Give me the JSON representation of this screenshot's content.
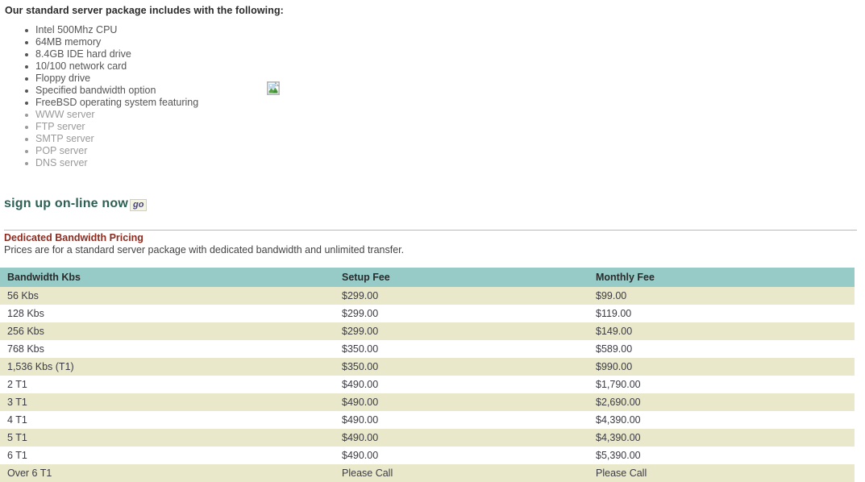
{
  "intro": {
    "heading": "Our standard server package includes with the following:",
    "features": [
      {
        "label": "Intel 500Mhz CPU",
        "muted": false
      },
      {
        "label": "64MB memory",
        "muted": false
      },
      {
        "label": "8.4GB IDE hard drive",
        "muted": false
      },
      {
        "label": "10/100 network card",
        "muted": false
      },
      {
        "label": "Floppy drive",
        "muted": false
      },
      {
        "label": "Specified bandwidth option",
        "muted": false
      },
      {
        "label": "FreeBSD operating system featuring",
        "muted": false
      },
      {
        "label": "WWW server",
        "muted": true
      },
      {
        "label": "FTP server",
        "muted": true
      },
      {
        "label": "SMTP server",
        "muted": true
      },
      {
        "label": "POP server",
        "muted": true
      },
      {
        "label": "DNS server",
        "muted": true
      }
    ]
  },
  "media": {
    "broken_image_alt": "broken-image-placeholder"
  },
  "signup": {
    "text": "sign up on-line now",
    "go_label": "go"
  },
  "pricing": {
    "title": "Dedicated Bandwidth Pricing",
    "subtitle": "Prices are for a standard server package with dedicated bandwidth and unlimited transfer.",
    "columns": [
      "Bandwidth Kbs",
      "Setup Fee",
      "Monthly Fee"
    ],
    "rows": [
      [
        "56 Kbs",
        "$299.00",
        "$99.00"
      ],
      [
        "128 Kbs",
        "$299.00",
        "$119.00"
      ],
      [
        "256 Kbs",
        "$299.00",
        "$149.00"
      ],
      [
        "768 Kbs",
        "$350.00",
        "$589.00"
      ],
      [
        "1,536 Kbs (T1)",
        "$350.00",
        "$990.00"
      ],
      [
        "2 T1",
        "$490.00",
        "$1,790.00"
      ],
      [
        "3 T1",
        "$490.00",
        "$2,690.00"
      ],
      [
        "4 T1",
        "$490.00",
        "$4,390.00"
      ],
      [
        "5 T1",
        "$490.00",
        "$4,390.00"
      ],
      [
        "6 T1",
        "$490.00",
        "$5,390.00"
      ],
      [
        "Over 6 T1",
        "Please Call",
        "Please Call"
      ]
    ]
  },
  "colors": {
    "table_header_bg": "#96cbc8",
    "table_row_alt_bg": "#e9e8cb",
    "pricing_title": "#8b2b1f",
    "signup_text": "#2c6055",
    "go_text": "#46467e",
    "go_bg": "#f5f3e2",
    "go_border": "#d6d0a8",
    "muted_text": "#9a9a9a"
  }
}
